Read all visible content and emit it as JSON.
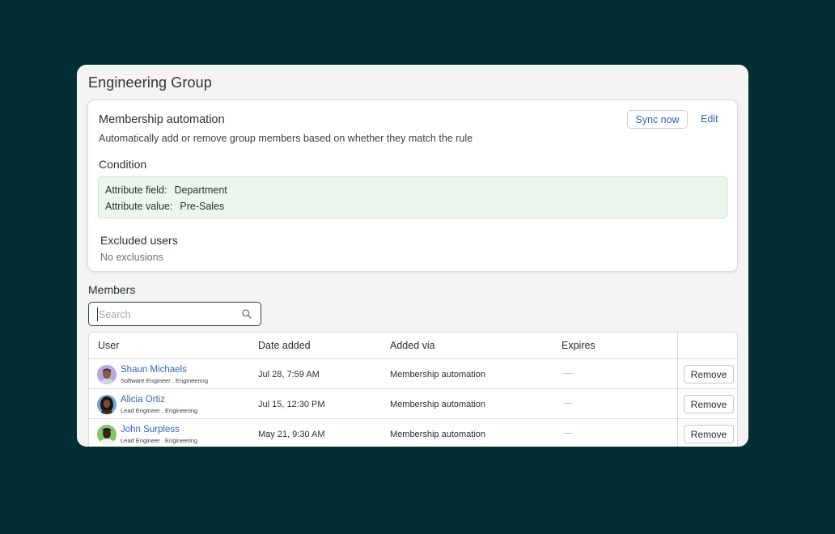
{
  "page": {
    "title": "Engineering Group"
  },
  "automation": {
    "title": "Membership automation",
    "description": "Automatically add or remove group members based on whether they match the rule",
    "sync_label": "Sync now",
    "edit_label": "Edit",
    "condition": {
      "title": "Condition",
      "field_label": "Attribute field:",
      "field_value": "Department",
      "value_label": "Attribute value:",
      "value_value": "Pre-Sales"
    },
    "excluded": {
      "title": "Excluded users",
      "value": "No exclusions"
    }
  },
  "members": {
    "title": "Members",
    "search_placeholder": "Search",
    "columns": [
      "User",
      "Date added",
      "Added via",
      "Expires"
    ],
    "rows": [
      {
        "name": "Shaun Michaels",
        "role": "Software Engineer . Engineering",
        "date": "Jul 28, 7:59 AM",
        "via": "Membership automation",
        "expires": "—",
        "action": "Remove"
      },
      {
        "name": "Alicia Ortiz",
        "role": "Lead Engineer . Engineering",
        "date": "Jul 15, 12:30 PM",
        "via": "Membership automation",
        "expires": "—",
        "action": "Remove"
      },
      {
        "name": "John Surpless",
        "role": "Lead Engineer . Engineering",
        "date": "May 21, 9:30 AM",
        "via": "Membership automation",
        "expires": "—",
        "action": "Remove"
      }
    ]
  },
  "colors": {
    "background": "#012f35",
    "accent": "#2d67b4",
    "condition_bg": "#ebf7ec"
  }
}
